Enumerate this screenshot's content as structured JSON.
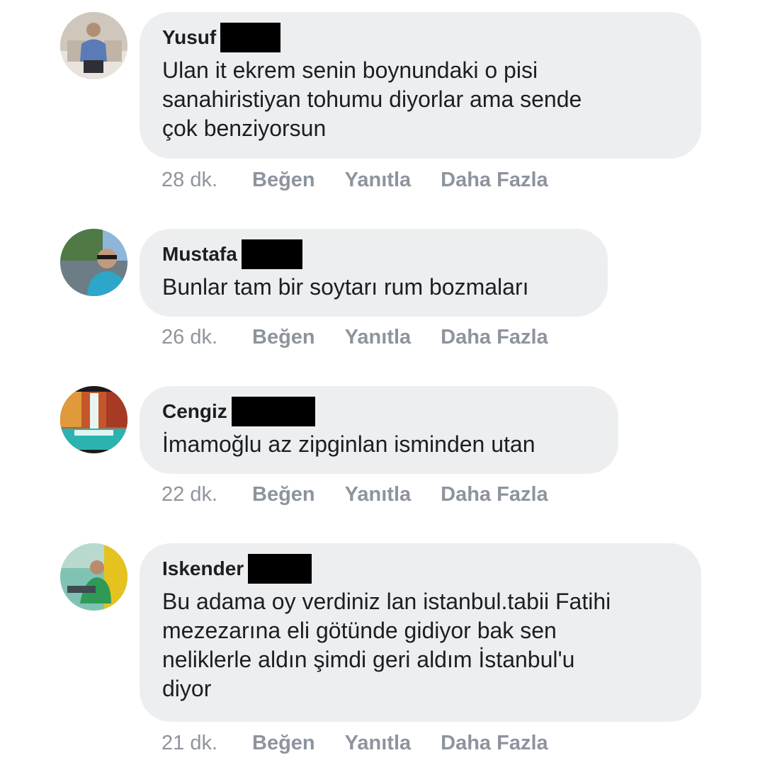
{
  "colors": {
    "bubble": "#eceef0",
    "text": "#1c1e21",
    "meta": "#90949c",
    "redaction": "#000000"
  },
  "actions": {
    "like": "Beğen",
    "reply": "Yanıtla",
    "more": "Daha Fazla"
  },
  "comments": [
    {
      "author": "Yusuf",
      "text": "Ulan it ekrem senin boynundaki o pisi\nsanahiristiyan tohumu diyorlar ama sende\nçok benziyorsun",
      "time": "28 dk.",
      "avatar_icon": "profile-photo-icon"
    },
    {
      "author": "Mustafa",
      "text": "Bunlar tam bir soytarı rum bozmaları",
      "time": "26 dk.",
      "avatar_icon": "profile-photo-icon"
    },
    {
      "author": "Cengiz",
      "text": "İmamoğlu az zipginlan isminden utan",
      "time": "22 dk.",
      "avatar_icon": "profile-photo-icon"
    },
    {
      "author": "Iskender",
      "text": "Bu adama oy verdiniz lan istanbul.tabii Fatihi\nmezezarına eli götünde gidiyor bak sen\nneliklerle aldın şimdi geri aldım İstanbul'u\ndiyor",
      "time": "21 dk.",
      "avatar_icon": "profile-photo-icon"
    }
  ]
}
